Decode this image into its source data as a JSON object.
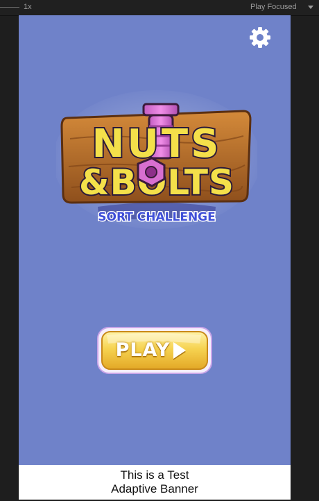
{
  "editor": {
    "scale": "1x",
    "mode": "Play Focused"
  },
  "game": {
    "settings_icon": "gear-icon",
    "logo": {
      "line1": "NUTS",
      "line2": "&BOLTS",
      "subtitle": "SORT CHALLENGE"
    },
    "play_button": {
      "label": "PLAY",
      "icon": "play-arrow-icon"
    }
  },
  "ad_banner": {
    "line1": "This is a Test",
    "line2": "Adaptive Banner"
  },
  "colors": {
    "background": "#6f82c9",
    "logo_yellow": "#f4e04a",
    "logo_pink": "#d86fd0",
    "wood": "#b8712d",
    "subtitle_blue": "#3f4fd8",
    "play_gold": "#f2c93a"
  }
}
